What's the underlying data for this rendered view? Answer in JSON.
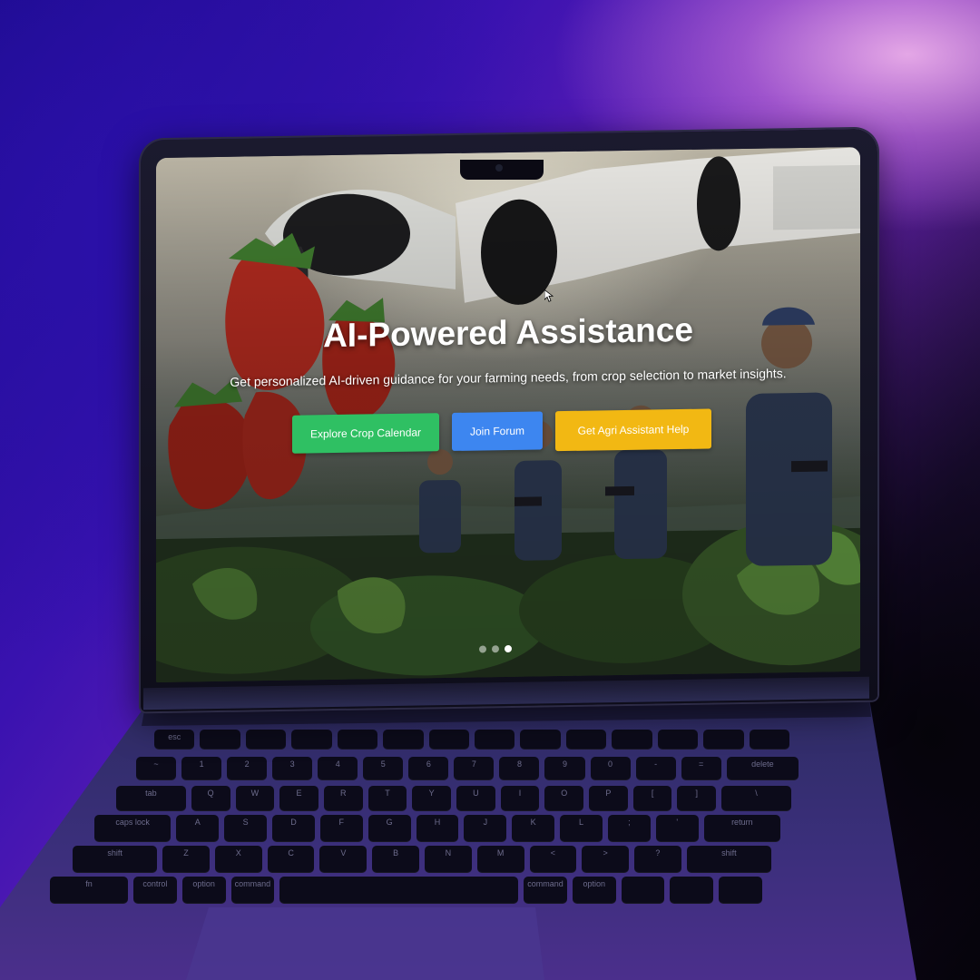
{
  "hero": {
    "title": "AI-Powered Assistance",
    "subtitle": "Get personalized AI-driven guidance for your farming needs, from crop selection to market insights.",
    "buttons": [
      {
        "label": "Explore Crop Calendar",
        "color": "#2fc063"
      },
      {
        "label": "Join Forum",
        "color": "#3d86f0"
      },
      {
        "label": "Get Agri Assistant Help",
        "color": "#f2b813"
      }
    ]
  },
  "carousel": {
    "total": 3,
    "active": 3
  },
  "keyboard": {
    "row0": [
      "esc",
      "",
      "",
      "",
      "",
      "",
      "",
      "",
      "",
      "",
      "",
      "",
      "",
      ""
    ],
    "row1": [
      "~",
      "1",
      "2",
      "3",
      "4",
      "5",
      "6",
      "7",
      "8",
      "9",
      "0",
      "-",
      "=",
      "delete"
    ],
    "row2": [
      "tab",
      "Q",
      "W",
      "E",
      "R",
      "T",
      "Y",
      "U",
      "I",
      "O",
      "P",
      "[",
      "]",
      "\\"
    ],
    "row3": [
      "caps lock",
      "A",
      "S",
      "D",
      "F",
      "G",
      "H",
      "J",
      "K",
      "L",
      ";",
      "'",
      "return"
    ],
    "row4": [
      "shift",
      "Z",
      "X",
      "C",
      "V",
      "B",
      "N",
      "M",
      "<",
      ">",
      "?",
      "shift"
    ],
    "row5": [
      "fn",
      "control",
      "option",
      "command",
      "",
      "command",
      "option",
      "",
      "",
      ""
    ]
  },
  "colors": {
    "accent_purple": "#6b22b8",
    "laptop_body": "#2a2a55"
  }
}
